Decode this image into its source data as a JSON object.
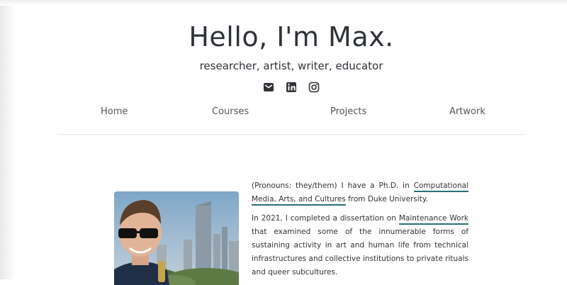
{
  "header": {
    "title": "Hello, I'm Max.",
    "subtitle": "researcher, artist, writer, educator",
    "social_icons": [
      "email-icon",
      "linkedin-icon",
      "instagram-icon"
    ]
  },
  "nav": {
    "items": [
      "Home",
      "Courses",
      "Projects",
      "Artwork"
    ]
  },
  "bio": {
    "p1_before": "(Pronouns: they/them) I have a Ph.D. in ",
    "p1_link": "Computational Media, Arts, and Cultures",
    "p1_after": " from Duke University.",
    "p2_before": "In 2021, I completed a dissertation on ",
    "p2_link": "Maintenance Work",
    "p2_after": " that examined some of the innumerable forms of sustaining activity in art and human life from technical infrastructures and collective institutions to private rituals and queer subcultures."
  },
  "colors": {
    "link_underline": "#2a6f78",
    "text": "#2f3338"
  }
}
